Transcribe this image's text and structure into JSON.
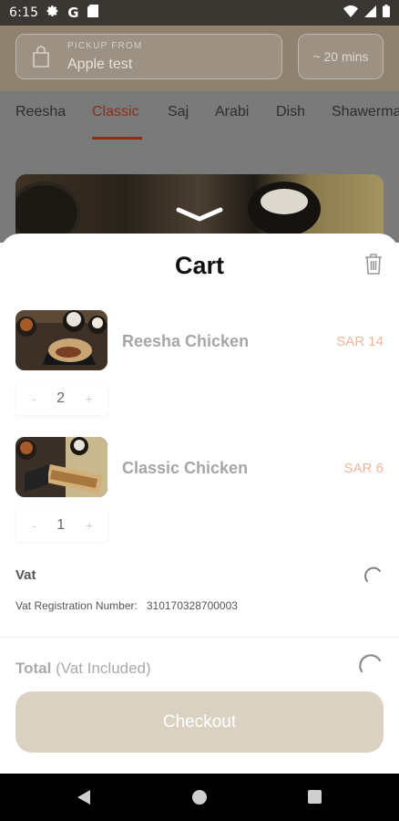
{
  "status_bar": {
    "time": "6:15",
    "g_label": "G",
    "icons": [
      "gear-icon",
      "google-g-icon",
      "sd-card-icon",
      "wifi-icon",
      "signal-icon",
      "battery-icon"
    ]
  },
  "header": {
    "pickup_label": "PICKUP FROM",
    "pickup_value": "Apple test",
    "eta": "~ 20 mins"
  },
  "tabs": [
    {
      "label": "Reesha"
    },
    {
      "label": "Classic",
      "active": true
    },
    {
      "label": "Saj"
    },
    {
      "label": "Arabi"
    },
    {
      "label": "Dish"
    },
    {
      "label": "Shawerma"
    }
  ],
  "cart": {
    "title": "Cart",
    "items": [
      {
        "name": "Reesha Chicken",
        "price": "SAR 14",
        "quantity": "2",
        "minus": "-",
        "plus": "+"
      },
      {
        "name": "Classic Chicken",
        "price": "SAR 6",
        "quantity": "1",
        "minus": "-",
        "plus": "+"
      }
    ],
    "vat_label": "Vat",
    "vat_reg_label": "Vat Registration Number:",
    "vat_reg_number": "310170328700003",
    "total_label": "Total",
    "total_note": "(Vat Included)",
    "checkout_label": "Checkout"
  },
  "colors": {
    "accent": "#8c2f17",
    "price": "#f0b59a",
    "checkout_bg": "#dbd1c3"
  }
}
